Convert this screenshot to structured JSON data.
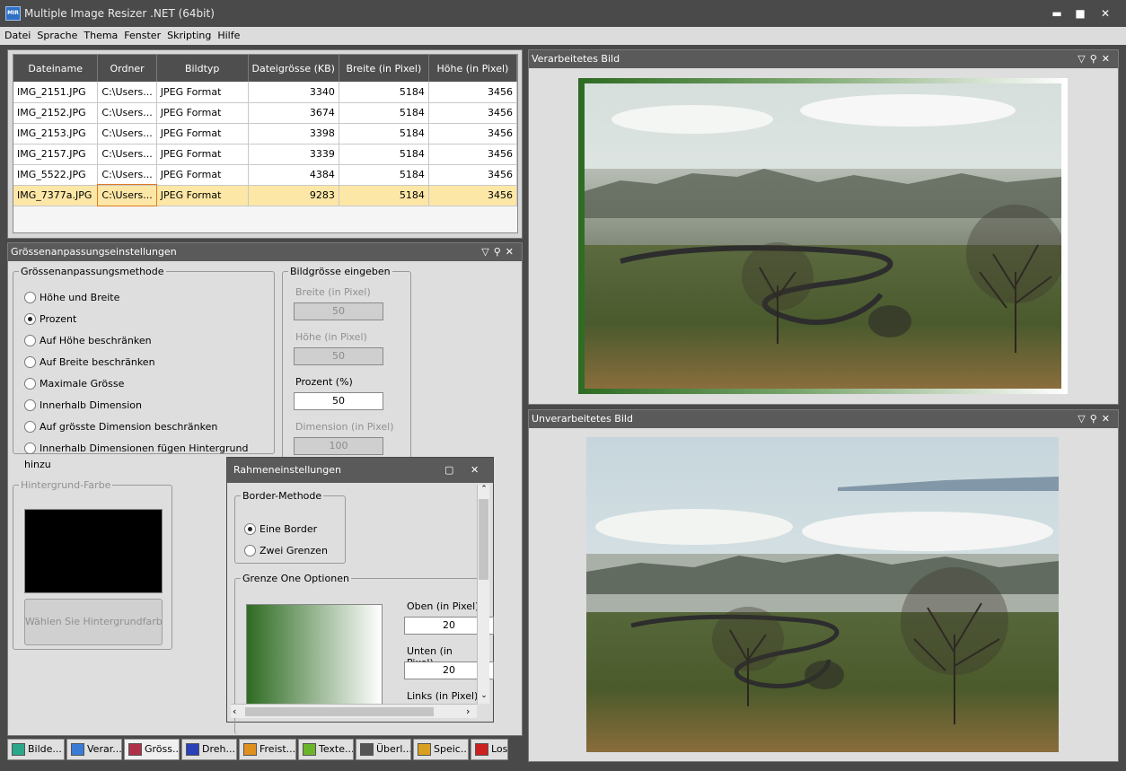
{
  "window": {
    "title": "Multiple Image Resizer .NET (64bit)",
    "app_icon_text": "MIR",
    "minimize": "▬",
    "maximize": "■",
    "close": "✕"
  },
  "menu": [
    "Datei",
    "Sprache",
    "Thema",
    "Fenster",
    "Skripting",
    "Hilfe"
  ],
  "table": {
    "columns": [
      "Dateiname",
      "Ordner",
      "Bildtyp",
      "Dateigrösse (KB)",
      "Breite (in Pixel)",
      "Höhe (in Pixel)"
    ],
    "rows": [
      [
        "IMG_2151.JPG",
        "C:\\Users...",
        "JPEG Format",
        "3340",
        "5184",
        "3456"
      ],
      [
        "IMG_2152.JPG",
        "C:\\Users...",
        "JPEG Format",
        "3674",
        "5184",
        "3456"
      ],
      [
        "IMG_2153.JPG",
        "C:\\Users...",
        "JPEG Format",
        "3398",
        "5184",
        "3456"
      ],
      [
        "IMG_2157.JPG",
        "C:\\Users...",
        "JPEG Format",
        "3339",
        "5184",
        "3456"
      ],
      [
        "IMG_5522.JPG",
        "C:\\Users...",
        "JPEG Format",
        "4384",
        "5184",
        "3456"
      ],
      [
        "IMG_7377a.JPG",
        "C:\\Users...",
        "JPEG Format",
        "9283",
        "5184",
        "3456"
      ]
    ],
    "selected_row": 5
  },
  "resize_panel": {
    "title": "Grössenanpassungseinstellungen",
    "method_group": "Grössenanpassungsmethode",
    "methods": [
      "Höhe und Breite",
      "Prozent",
      "Auf Höhe beschränken",
      "Auf Breite beschränken",
      "Maximale Grösse",
      "Innerhalb Dimension",
      "Auf grösste Dimension beschränken",
      "Innerhalb Dimensionen fügen Hintergrund hinzu"
    ],
    "selected_method": 1,
    "size_group": "Bildgrösse eingeben",
    "width_label": "Breite (in Pixel)",
    "width_value": "50",
    "height_label": "Höhe (in Pixel)",
    "height_value": "50",
    "percent_label": "Prozent (%)",
    "percent_value": "50",
    "dimension_label": "Dimension (in Pixel)",
    "dimension_value": "100",
    "bg_group": "Hintergrund-Farbe",
    "bg_color": "#000000",
    "bg_button": "Wählen Sie Hintergrundfarbe"
  },
  "border_dialog": {
    "title": "Rahmeneinstellungen",
    "method_group": "Border-Methode",
    "options": [
      "Eine Border",
      "Zwei Grenzen"
    ],
    "selected": 0,
    "options_group": "Grenze One Optionen",
    "top_label": "Oben (in Pixel)",
    "top_value": "20",
    "bottom_label": "Unten (in Pixel)",
    "bottom_value": "20",
    "left_label": "Links (in Pixel)",
    "gradient_from": "#2e6b22",
    "gradient_to": "#ffffff"
  },
  "processed_panel": {
    "title": "Verarbeitetes Bild"
  },
  "original_panel": {
    "title": "Unverarbeitetes Bild"
  },
  "tabs": [
    {
      "label": "Bilde...",
      "icon": "images-icon",
      "color": "#2aa889"
    },
    {
      "label": "Verar...",
      "icon": "check-icon",
      "color": "#3a7bd5"
    },
    {
      "label": "Gröss...",
      "icon": "resize-icon",
      "color": "#b0304a"
    },
    {
      "label": "Dreh...",
      "icon": "rotate-icon",
      "color": "#2a3fb8"
    },
    {
      "label": "Freist...",
      "icon": "crop-icon",
      "color": "#e0901e"
    },
    {
      "label": "Texte...",
      "icon": "text-icon",
      "color": "#6bb52a"
    },
    {
      "label": "Überl...",
      "icon": "overlay-icon",
      "color": "#555555"
    },
    {
      "label": "Speic...",
      "icon": "save-icon",
      "color": "#d9a020"
    },
    {
      "label": "Los",
      "icon": "play-icon",
      "color": "#cc2020"
    }
  ],
  "active_tab": 2
}
